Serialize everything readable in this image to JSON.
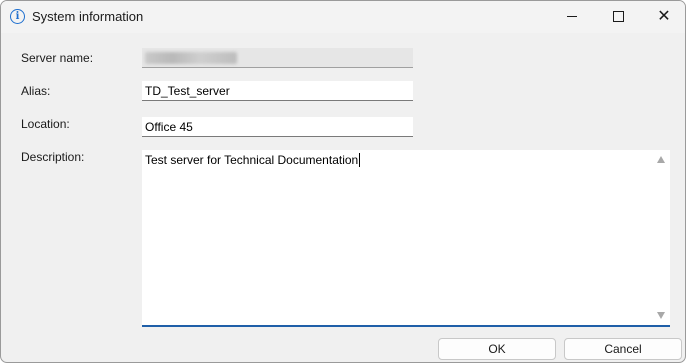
{
  "window": {
    "title": "System information",
    "icon": "info-icon",
    "controls": {
      "minimize": "minimize-icon",
      "maximize": "maximize-icon",
      "close": "close-icon"
    }
  },
  "form": {
    "server_name": {
      "label": "Server name:",
      "value": ""
    },
    "alias": {
      "label": "Alias:",
      "value": "TD_Test_server"
    },
    "location": {
      "label": "Location:",
      "value": "Office 45"
    },
    "description": {
      "label": "Description:",
      "value": "Test server for Technical Documentation"
    }
  },
  "buttons": {
    "ok": "OK",
    "cancel": "Cancel"
  },
  "colors": {
    "accent": "#1f5fa8",
    "info_icon": "#1e6fcf"
  }
}
